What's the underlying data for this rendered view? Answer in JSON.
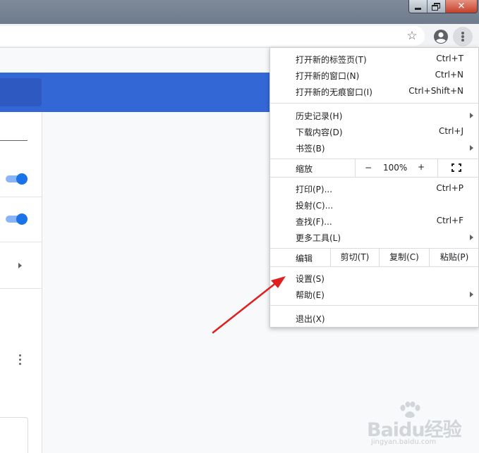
{
  "window": {
    "minimize_icon": "minimize-icon",
    "maximize_icon": "restore-icon",
    "close_icon": "close-icon",
    "close_glyph": "✕"
  },
  "toolbar": {
    "star_glyph": "☆",
    "star_icon": "bookmark-star-icon",
    "profile_icon": "profile-avatar-icon",
    "menu_icon": "three-dots-vertical-icon"
  },
  "colors": {
    "accent_blue": "#3367d6",
    "toggle_blue": "#1a73e8",
    "annotation_red": "#e02020"
  },
  "menu": {
    "new_tab": {
      "label": "打开新的标签页(T)",
      "shortcut": "Ctrl+T"
    },
    "new_window": {
      "label": "打开新的窗口(N)",
      "shortcut": "Ctrl+N"
    },
    "new_incognito": {
      "label": "打开新的无痕窗口(I)",
      "shortcut": "Ctrl+Shift+N"
    },
    "history": {
      "label": "历史记录(H)"
    },
    "downloads": {
      "label": "下载内容(D)",
      "shortcut": "Ctrl+J"
    },
    "bookmarks": {
      "label": "书签(B)"
    },
    "zoom": {
      "label": "缩放",
      "minus": "−",
      "value": "100%",
      "plus": "+"
    },
    "print": {
      "label": "打印(P)...",
      "shortcut": "Ctrl+P"
    },
    "cast": {
      "label": "投射(C)..."
    },
    "find": {
      "label": "查找(F)...",
      "shortcut": "Ctrl+F"
    },
    "more_tools": {
      "label": "更多工具(L)"
    },
    "edit": {
      "label": "编辑",
      "cut": "剪切(T)",
      "copy": "复制(C)",
      "paste": "粘贴(P)"
    },
    "settings": {
      "label": "设置(S)"
    },
    "help": {
      "label": "帮助(E)"
    },
    "exit": {
      "label": "退出(X)"
    }
  },
  "watermark": {
    "logo": "Baidu经验",
    "url": "jingyan.baidu.com"
  }
}
